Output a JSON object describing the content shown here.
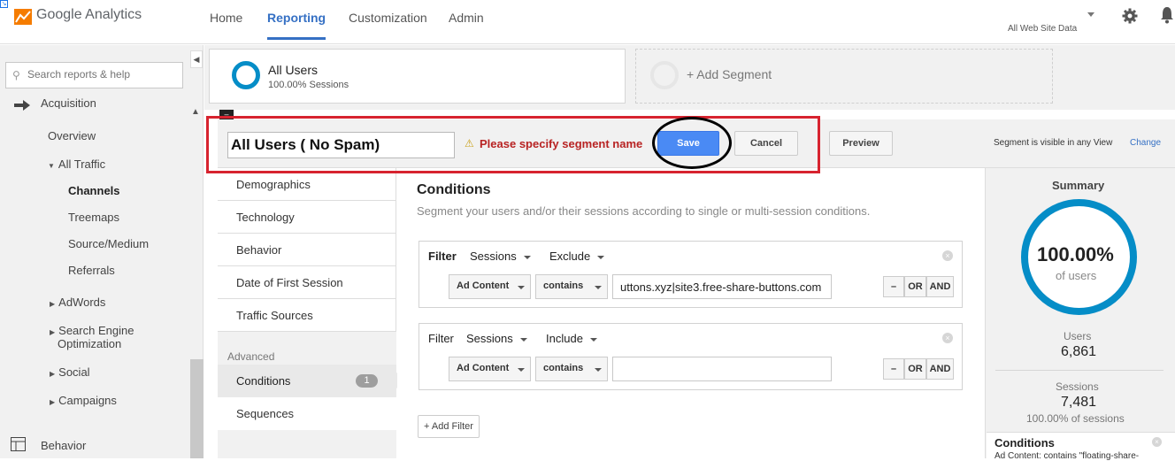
{
  "app": {
    "name": "Google Analytics"
  },
  "nav": {
    "tabs": [
      "Home",
      "Reporting",
      "Customization",
      "Admin"
    ],
    "active": "Reporting"
  },
  "account": {
    "view": "All Web Site Data"
  },
  "search": {
    "placeholder": "Search reports & help"
  },
  "sidebar": {
    "partial_top": "Acquisition",
    "items": {
      "overview": "Overview",
      "all_traffic": "All Traffic",
      "channels": "Channels",
      "treemaps": "Treemaps",
      "source_medium": "Source/Medium",
      "referrals": "Referrals",
      "adwords": "AdWords",
      "seo_line1": "Search Engine",
      "seo_line2": "Optimization",
      "social": "Social",
      "campaigns": "Campaigns",
      "behavior": "Behavior"
    }
  },
  "segments": {
    "selected": {
      "name": "All Users",
      "sub": "100.00% Sessions"
    },
    "add_label": "+ Add Segment"
  },
  "editor": {
    "name_value": "All Users ( No Spam)",
    "warning": "Please specify segment name",
    "save": "Save",
    "cancel": "Cancel",
    "preview": "Preview",
    "visibility_text": "Segment is visible in any View",
    "visibility_link": "Change"
  },
  "categories": {
    "items": [
      "Demographics",
      "Technology",
      "Behavior",
      "Date of First Session",
      "Traffic Sources"
    ],
    "advanced_label": "Advanced",
    "conditions": "Conditions",
    "conditions_count": "1",
    "sequences": "Sequences"
  },
  "conditions": {
    "title": "Conditions",
    "subtitle": "Segment your users and/or their sessions according to single or multi-session conditions.",
    "filter_label": "Filter",
    "filters": [
      {
        "scope": "Sessions",
        "mode": "Exclude",
        "dimension": "Ad Content",
        "operator": "contains",
        "value": "uttons.xyz|site3.free-share-buttons.com"
      },
      {
        "scope": "Sessions",
        "mode": "Include",
        "dimension": "Ad Content",
        "operator": "contains",
        "value": ""
      }
    ],
    "minus": "–",
    "or": "OR",
    "and": "AND",
    "add_filter": "+ Add Filter"
  },
  "summary": {
    "title": "Summary",
    "percent": "100.00%",
    "percent_sub": "of users",
    "users_label": "Users",
    "users_value": "6,861",
    "sessions_label": "Sessions",
    "sessions_value": "7,481",
    "sessions_pct": "100.00% of sessions",
    "conditions_title": "Conditions",
    "conditions_text": "Ad Content: contains \"floating-share-"
  },
  "colors": {
    "accent": "#3570c4",
    "save": "#4a8af4",
    "warning": "#b82323",
    "ring": "#058dc7",
    "annotation_red": "#d7232f"
  }
}
